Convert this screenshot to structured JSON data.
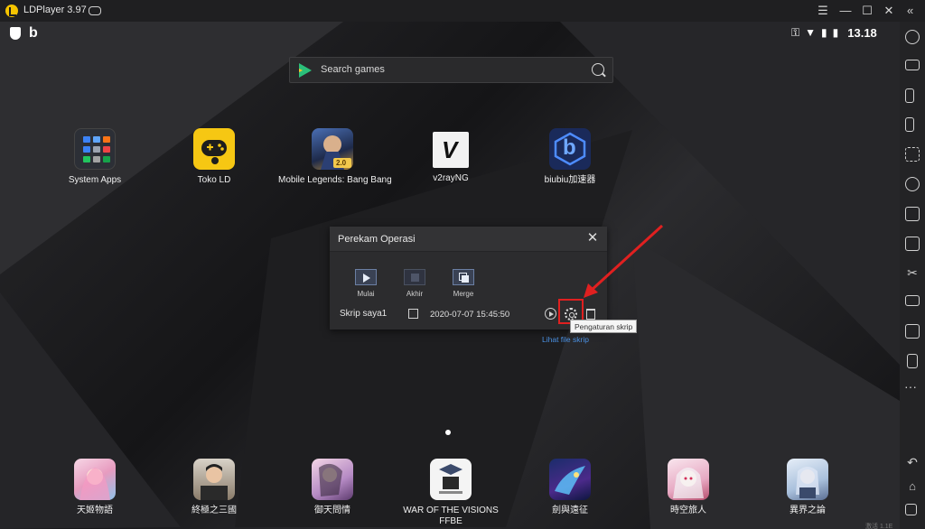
{
  "window": {
    "title": "LDPlayer 3.97",
    "controls": {
      "menu": "☰",
      "minimize": "—",
      "maximize": "☐",
      "close": "✕"
    }
  },
  "status_bar": {
    "time": "13.18",
    "b_logo": "b"
  },
  "search": {
    "placeholder": "Search games"
  },
  "apps_top": [
    {
      "label": "System Apps",
      "icon": "system-apps-icon"
    },
    {
      "label": "Toko LD",
      "icon": "toko-ld-icon",
      "color": "#f6c713"
    },
    {
      "label": "Mobile Legends: Bang Bang",
      "icon": "mobile-legends-icon",
      "badge": "2.0"
    },
    {
      "label": "v2rayNG",
      "icon": "v2rayng-icon",
      "glyph": "V"
    },
    {
      "label": "biubiu加速器",
      "icon": "biubiu-icon",
      "glyph": "b"
    }
  ],
  "dialog": {
    "title": "Perekam Operasi",
    "controls": [
      "Mulai",
      "Akhir",
      "Merge"
    ],
    "script": {
      "name": "Skrip saya1",
      "time": "2020-07-07 15:45:50"
    },
    "tooltip": "Pengaturan skrip",
    "link": "Lihat file skrip"
  },
  "apps_bottom": [
    {
      "label": "天姬物語",
      "icon": "game-icon"
    },
    {
      "label": "終極之三國",
      "icon": "game-icon"
    },
    {
      "label": "御天問情",
      "icon": "game-icon"
    },
    {
      "label": "WAR OF THE VISIONS FFBE",
      "label2": "FFBE",
      "label1": "WAR OF THE VISIONS",
      "icon": "game-icon"
    },
    {
      "label": "劍與遠征",
      "icon": "game-icon"
    },
    {
      "label": "時空旅人",
      "icon": "game-icon"
    },
    {
      "label": "異界之論",
      "icon": "game-icon"
    }
  ],
  "toolbar": {
    "collapse": "«",
    "more": "···"
  },
  "watermark": "激活 1.1E",
  "colors": {
    "accent": "#f5c400",
    "highlight": "#e02020",
    "link": "#4a90e2"
  }
}
